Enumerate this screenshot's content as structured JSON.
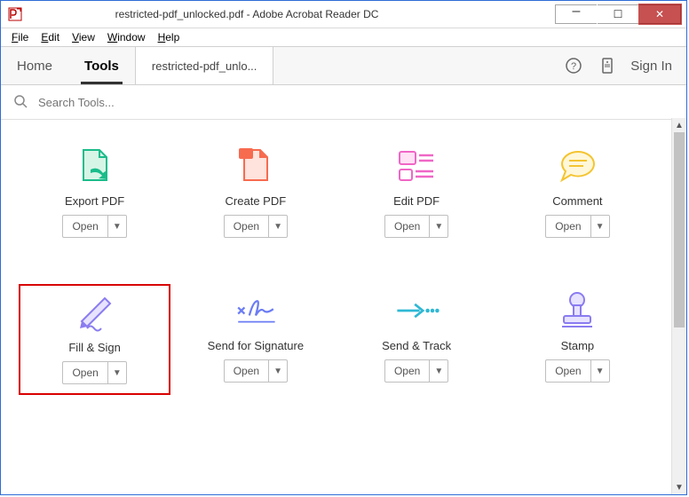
{
  "window": {
    "title": "restricted-pdf_unlocked.pdf - Adobe Acrobat Reader DC"
  },
  "menu": {
    "file": "File",
    "edit": "Edit",
    "view": "View",
    "window": "Window",
    "help": "Help"
  },
  "tabs": {
    "home": "Home",
    "tools": "Tools",
    "document": "restricted-pdf_unlo..."
  },
  "header": {
    "signin": "Sign In"
  },
  "search": {
    "placeholder": "Search Tools..."
  },
  "buttons": {
    "open": "Open"
  },
  "tools": [
    {
      "label": "Export PDF"
    },
    {
      "label": "Create PDF"
    },
    {
      "label": "Edit PDF"
    },
    {
      "label": "Comment"
    },
    {
      "label": "Fill & Sign"
    },
    {
      "label": "Send for Signature"
    },
    {
      "label": "Send & Track"
    },
    {
      "label": "Stamp"
    }
  ]
}
